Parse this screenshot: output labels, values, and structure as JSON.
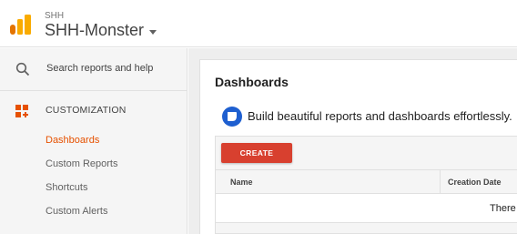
{
  "header": {
    "account": "SHH",
    "property": "SHH-Monster"
  },
  "sidebar": {
    "search_placeholder": "Search reports and help",
    "section_title": "CUSTOMIZATION",
    "items": [
      {
        "label": "Dashboards",
        "active": true
      },
      {
        "label": "Custom Reports",
        "active": false
      },
      {
        "label": "Shortcuts",
        "active": false
      },
      {
        "label": "Custom Alerts",
        "active": false
      }
    ]
  },
  "main": {
    "title": "Dashboards",
    "promo": "Build beautiful reports and dashboards effortlessly.",
    "create_label": "CREATE",
    "columns": [
      "Name",
      "Creation Date"
    ],
    "empty_text": "There"
  },
  "colors": {
    "accent": "#e65100",
    "create_button": "#d8402f",
    "logo": "#f9ab00"
  }
}
